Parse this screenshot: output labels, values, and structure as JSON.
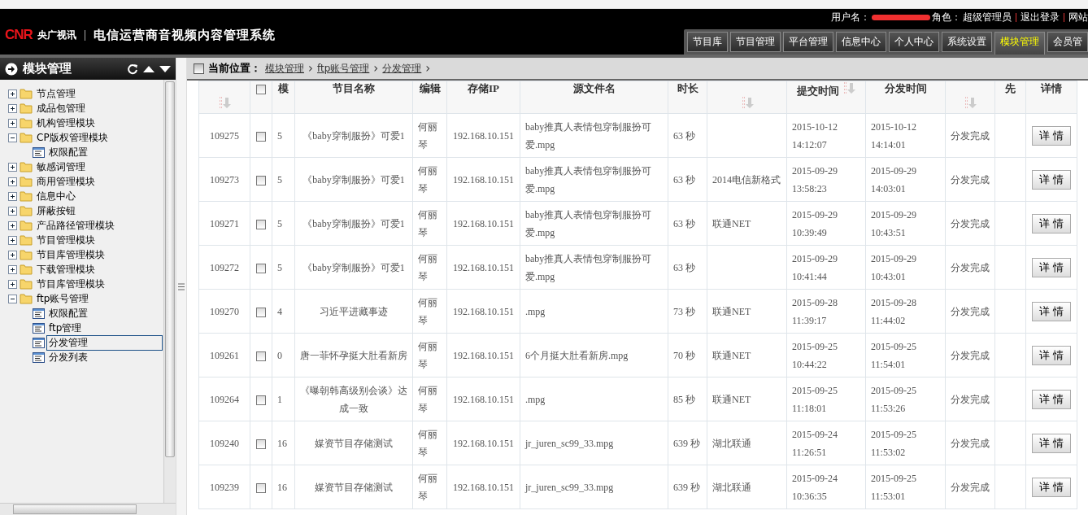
{
  "header": {
    "logo": "CNR",
    "brand": "央广视讯",
    "system_title": "电信运营商音视频内容管理系统",
    "user_label": "用户名：",
    "role_label": "角色：",
    "role": "超级管理员",
    "logout": "退出登录",
    "site_link": "网站"
  },
  "nav_tabs": [
    {
      "label": "节目库",
      "selected": false
    },
    {
      "label": "节目管理",
      "selected": false
    },
    {
      "label": "平台管理",
      "selected": false
    },
    {
      "label": "信息中心",
      "selected": false
    },
    {
      "label": "个人中心",
      "selected": false
    },
    {
      "label": "系统设置",
      "selected": false
    },
    {
      "label": "模块管理",
      "selected": true
    },
    {
      "label": "会员管",
      "selected": false
    }
  ],
  "sidebar": {
    "title": "模块管理",
    "tree": [
      {
        "label": "节点管理",
        "kind": "folder",
        "expanded": false,
        "selected": false
      },
      {
        "label": "成品包管理",
        "kind": "folder",
        "expanded": false,
        "selected": false
      },
      {
        "label": "机构管理模块",
        "kind": "folder",
        "expanded": false,
        "selected": false
      },
      {
        "label": "CP版权管理模块",
        "kind": "folder",
        "expanded": true,
        "selected": false,
        "children": [
          {
            "label": "权限配置",
            "kind": "page",
            "selected": false
          }
        ]
      },
      {
        "label": "敏感词管理",
        "kind": "folder",
        "expanded": false,
        "selected": false
      },
      {
        "label": "商用管理模块",
        "kind": "folder",
        "expanded": false,
        "selected": false
      },
      {
        "label": "信息中心",
        "kind": "folder",
        "expanded": false,
        "selected": false
      },
      {
        "label": "屏蔽按钮",
        "kind": "folder",
        "expanded": false,
        "selected": false
      },
      {
        "label": "产品路径管理模块",
        "kind": "folder",
        "expanded": false,
        "selected": false
      },
      {
        "label": "节目管理模块",
        "kind": "folder",
        "expanded": false,
        "selected": false
      },
      {
        "label": "节目库管理模块",
        "kind": "folder",
        "expanded": false,
        "selected": false
      },
      {
        "label": "下载管理模块",
        "kind": "folder",
        "expanded": false,
        "selected": false
      },
      {
        "label": "节目库管理模块",
        "kind": "folder",
        "expanded": false,
        "selected": false
      },
      {
        "label": "ftp账号管理",
        "kind": "folder",
        "expanded": true,
        "selected": false,
        "children": [
          {
            "label": "权限配置",
            "kind": "page",
            "selected": false
          },
          {
            "label": "ftp管理",
            "kind": "page",
            "selected": false
          },
          {
            "label": "分发管理",
            "kind": "page",
            "selected": true
          },
          {
            "label": "分发列表",
            "kind": "page",
            "selected": false
          }
        ]
      }
    ]
  },
  "breadcrumb": {
    "label": "当前位置：",
    "items": [
      "模块管理",
      "ftp账号管理",
      "分发管理"
    ],
    "separator": "›"
  },
  "table": {
    "columns": [
      {
        "kind": "text",
        "sortable": true
      },
      {
        "kind": "checkbox",
        "checked": false
      },
      {
        "kind": "text",
        "label": "模",
        "sortable": false
      },
      {
        "kind": "text",
        "label": "节目名称",
        "sortable": false
      },
      {
        "kind": "text",
        "label": "编辑",
        "sortable": false
      },
      {
        "kind": "text",
        "label": "存储IP",
        "sortable": false
      },
      {
        "kind": "text",
        "label": "源文件名",
        "sortable": false
      },
      {
        "kind": "text",
        "label": "时长",
        "sortable": false
      },
      {
        "kind": "text",
        "sortable": true
      },
      {
        "kind": "text",
        "label": "提交时间",
        "sortable": true
      },
      {
        "kind": "text",
        "label": "分发时间",
        "sortable": false
      },
      {
        "kind": "text",
        "sortable": true
      },
      {
        "kind": "text",
        "label": "先",
        "sortable": false
      },
      {
        "kind": "text",
        "label": "详情",
        "sortable": false
      }
    ],
    "rows": [
      {
        "id": "109275",
        "checked": false,
        "column_3": "5",
        "title": "《baby穿制服扮》可爱1",
        "editor": "何丽琴",
        "ip": "192.168.10.151",
        "file": "baby推真人表情包穿制服扮可爱.mpg",
        "duration": "63 秒",
        "submit_time": "2015-10-12 14:12:07",
        "dist_time": "2015-10-12 14:14:01",
        "column_12": "分发完成",
        "action": "详 情"
      },
      {
        "id": "109273",
        "checked": false,
        "column_3": "5",
        "title": "《baby穿制服扮》可爱1",
        "editor": "何丽琴",
        "ip": "192.168.10.151",
        "file": "baby推真人表情包穿制服扮可爱.mpg",
        "duration": "63 秒",
        "column_9": "2014电信新格式",
        "submit_time": "2015-09-29 13:58:23",
        "dist_time": "2015-09-29 14:03:01",
        "column_12": "分发完成",
        "action": "详 情"
      },
      {
        "id": "109271",
        "checked": false,
        "column_3": "5",
        "title": "《baby穿制服扮》可爱1",
        "editor": "何丽琴",
        "ip": "192.168.10.151",
        "file": "baby推真人表情包穿制服扮可爱.mpg",
        "duration": "63 秒",
        "column_9": "联通NET",
        "submit_time": "2015-09-29 10:39:49",
        "dist_time": "2015-09-29 10:43:51",
        "column_12": "分发完成",
        "action": "详 情"
      },
      {
        "id": "109272",
        "checked": false,
        "column_3": "5",
        "title": "《baby穿制服扮》可爱1",
        "editor": "何丽琴",
        "ip": "192.168.10.151",
        "file": "baby推真人表情包穿制服扮可爱.mpg",
        "duration": "63 秒",
        "submit_time": "2015-09-29 10:41:44",
        "dist_time": "2015-09-29 10:43:01",
        "column_12": "分发完成",
        "action": "详 情"
      },
      {
        "id": "109270",
        "checked": false,
        "column_3": "4",
        "title": "习近平进藏事迹",
        "editor": "何丽琴",
        "ip": "192.168.10.151",
        "file": ".mpg",
        "duration": "73 秒",
        "column_9": "联通NET",
        "submit_time": "2015-09-28 11:39:17",
        "dist_time": "2015-09-28 11:44:02",
        "column_12": "分发完成",
        "action": "详 情"
      },
      {
        "id": "109261",
        "checked": false,
        "column_3": "0",
        "title": "唐一菲怀孕挺大肚看新房",
        "editor": "何丽琴",
        "ip": "192.168.10.151",
        "file": "6个月挺大肚看新房.mpg",
        "duration": "70 秒",
        "column_9": "联通NET",
        "submit_time": "2015-09-25 10:44:22",
        "dist_time": "2015-09-25 11:54:01",
        "column_12": "分发完成",
        "action": "详 情"
      },
      {
        "id": "109264",
        "checked": false,
        "column_3": "1",
        "title": "《曝朝韩高级别会谈》达成一致",
        "editor": "何丽琴",
        "ip": "192.168.10.151",
        "file": ".mpg",
        "duration": "85 秒",
        "column_9": "联通NET",
        "submit_time": "2015-09-25 11:18:01",
        "dist_time": "2015-09-25 11:53:26",
        "column_12": "分发完成",
        "action": "详 情"
      },
      {
        "id": "109240",
        "checked": false,
        "column_3": "16",
        "title": "媒资节目存储测试",
        "editor": "何丽琴",
        "ip": "192.168.10.151",
        "file": "jr_juren_sc99_33.mpg",
        "duration": "639 秒",
        "column_9": "湖北联通",
        "submit_time": "2015-09-24 11:26:51",
        "dist_time": "2015-09-25 11:53:02",
        "column_12": "分发完成",
        "action": "详 情"
      },
      {
        "id": "109239",
        "checked": false,
        "column_3": "16",
        "title": "媒资节目存储测试",
        "editor": "何丽琴",
        "ip": "192.168.10.151",
        "file": "jr_juren_sc99_33.mpg",
        "duration": "639 秒",
        "column_9": "湖北联通",
        "submit_time": "2015-09-24 10:36:35",
        "dist_time": "2015-09-25 11:53:01",
        "column_12": "分发完成",
        "action": "详 情"
      }
    ]
  }
}
